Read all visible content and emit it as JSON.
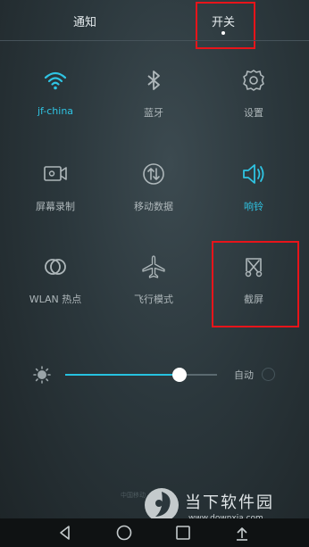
{
  "tabs": {
    "notify": "通知",
    "switch": "开关"
  },
  "tiles": [
    {
      "label": "jf-china",
      "icon": "wifi-icon",
      "active": true
    },
    {
      "label": "蓝牙",
      "icon": "bluetooth-icon"
    },
    {
      "label": "设置",
      "icon": "gear-icon"
    },
    {
      "label": "屏幕录制",
      "icon": "screen-record-icon"
    },
    {
      "label": "移动数据",
      "icon": "mobile-data-icon"
    },
    {
      "label": "响铃",
      "icon": "speaker-icon",
      "active": true
    },
    {
      "label": "WLAN 热点",
      "icon": "hotspot-icon"
    },
    {
      "label": "飞行模式",
      "icon": "airplane-icon"
    },
    {
      "label": "截屏",
      "icon": "screenshot-icon"
    }
  ],
  "brightness": {
    "auto_label": "自动",
    "level": 0.75
  },
  "watermark": {
    "site_text": "中国移动",
    "logo_title": "当下软件园",
    "logo_url": "www.downxia.com"
  },
  "colors": {
    "accent": "#2fc4e3",
    "highlight": "#e8141a"
  }
}
